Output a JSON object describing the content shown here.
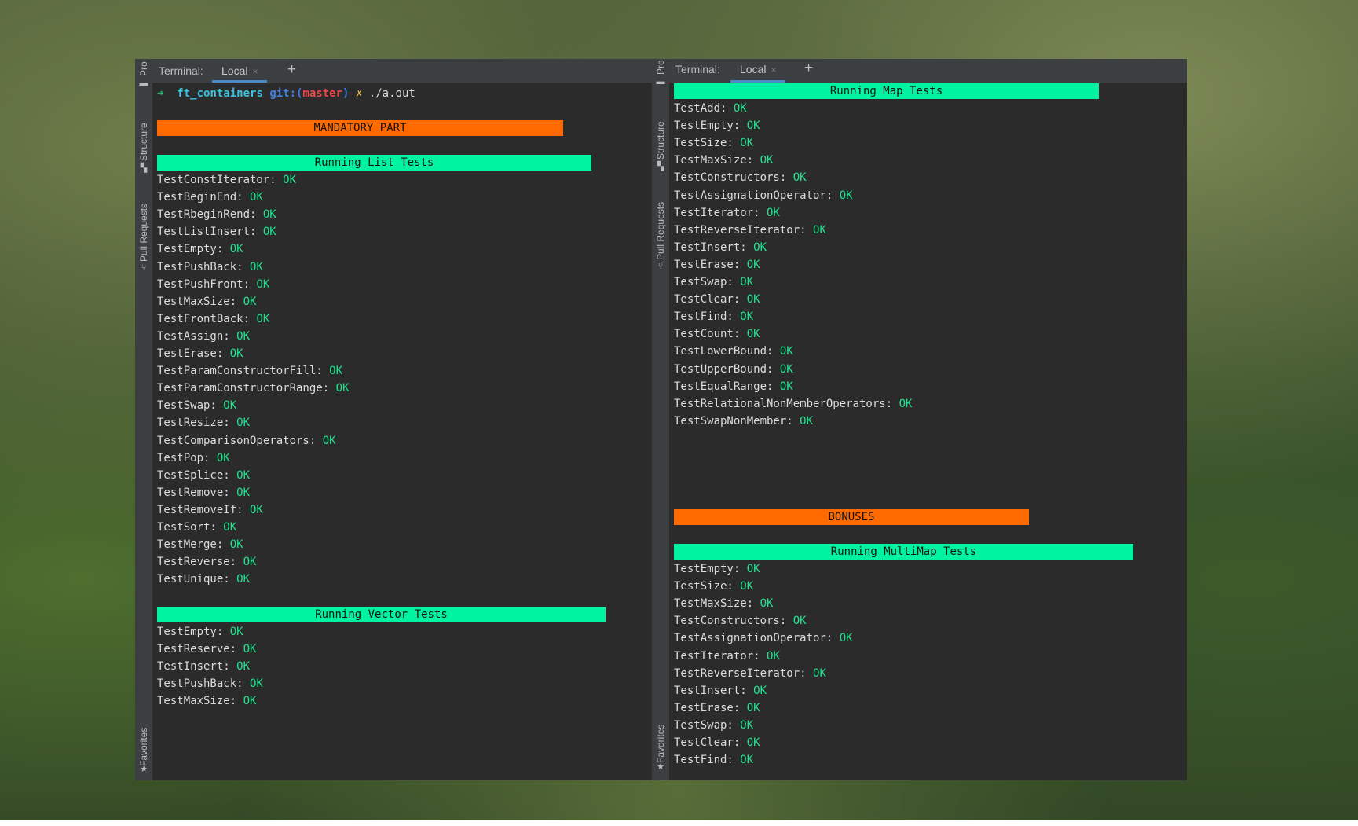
{
  "left_window": {
    "sidebar": {
      "top_label": "Pro",
      "structure": "Structure",
      "pull_requests": "Pull Requests",
      "favorites": "Favorites"
    },
    "tabbar": {
      "title": "Terminal:",
      "tab": "Local",
      "close": "×",
      "add": "+"
    },
    "prompt": {
      "arrow": "➜",
      "dir": "ft_containers",
      "git": "git:(",
      "branch": "master",
      "git_close": ")",
      "dirty": "✗",
      "command": "./a.out"
    },
    "mandatory_banner": "MANDATORY PART",
    "list_banner": "Running List Tests",
    "list_tests": [
      {
        "name": "TestConstIterator:",
        "status": "OK"
      },
      {
        "name": "TestBeginEnd:",
        "status": "OK"
      },
      {
        "name": "TestRbeginRend:",
        "status": "OK"
      },
      {
        "name": "TestListInsert:",
        "status": "OK"
      },
      {
        "name": "TestEmpty:",
        "status": "OK"
      },
      {
        "name": "TestPushBack:",
        "status": "OK"
      },
      {
        "name": "TestPushFront:",
        "status": "OK"
      },
      {
        "name": "TestMaxSize:",
        "status": "OK"
      },
      {
        "name": "TestFrontBack:",
        "status": "OK"
      },
      {
        "name": "TestAssign:",
        "status": "OK"
      },
      {
        "name": "TestErase:",
        "status": "OK"
      },
      {
        "name": "TestParamConstructorFill:",
        "status": "OK"
      },
      {
        "name": "TestParamConstructorRange:",
        "status": "OK"
      },
      {
        "name": "TestSwap:",
        "status": "OK"
      },
      {
        "name": "TestResize:",
        "status": "OK"
      },
      {
        "name": "TestComparisonOperators:",
        "status": "OK"
      },
      {
        "name": "TestPop:",
        "status": "OK"
      },
      {
        "name": "TestSplice:",
        "status": "OK"
      },
      {
        "name": "TestRemove:",
        "status": "OK"
      },
      {
        "name": "TestRemoveIf:",
        "status": "OK"
      },
      {
        "name": "TestSort:",
        "status": "OK"
      },
      {
        "name": "TestMerge:",
        "status": "OK"
      },
      {
        "name": "TestReverse:",
        "status": "OK"
      },
      {
        "name": "TestUnique:",
        "status": "OK"
      }
    ],
    "vector_banner": "Running Vector Tests",
    "vector_tests": [
      {
        "name": "TestEmpty:",
        "status": "OK"
      },
      {
        "name": "TestReserve:",
        "status": "OK"
      },
      {
        "name": "TestInsert:",
        "status": "OK"
      },
      {
        "name": "TestPushBack:",
        "status": "OK"
      },
      {
        "name": "TestMaxSize:",
        "status": "OK"
      }
    ]
  },
  "right_window": {
    "sidebar": {
      "top_label": "Pro",
      "structure": "Structure",
      "pull_requests": "Pull Requests",
      "favorites": "Favorites"
    },
    "tabbar": {
      "title": "Terminal:",
      "tab": "Local",
      "close": "×",
      "add": "+"
    },
    "map_banner": "Running Map Tests",
    "map_tests": [
      {
        "name": "TestAdd:",
        "status": "OK"
      },
      {
        "name": "TestEmpty:",
        "status": "OK"
      },
      {
        "name": "TestSize:",
        "status": "OK"
      },
      {
        "name": "TestMaxSize:",
        "status": "OK"
      },
      {
        "name": "TestConstructors:",
        "status": "OK"
      },
      {
        "name": "TestAssignationOperator:",
        "status": "OK"
      },
      {
        "name": "TestIterator:",
        "status": "OK"
      },
      {
        "name": "TestReverseIterator:",
        "status": "OK"
      },
      {
        "name": "TestInsert:",
        "status": "OK"
      },
      {
        "name": "TestErase:",
        "status": "OK"
      },
      {
        "name": "TestSwap:",
        "status": "OK"
      },
      {
        "name": "TestClear:",
        "status": "OK"
      },
      {
        "name": "TestFind:",
        "status": "OK"
      },
      {
        "name": "TestCount:",
        "status": "OK"
      },
      {
        "name": "TestLowerBound:",
        "status": "OK"
      },
      {
        "name": "TestUpperBound:",
        "status": "OK"
      },
      {
        "name": "TestEqualRange:",
        "status": "OK"
      },
      {
        "name": "TestRelationalNonMemberOperators:",
        "status": "OK"
      },
      {
        "name": "TestSwapNonMember:",
        "status": "OK"
      }
    ],
    "bonuses_banner": "BONUSES",
    "multimap_banner": "Running MultiMap Tests",
    "multimap_tests": [
      {
        "name": "TestEmpty:",
        "status": "OK"
      },
      {
        "name": "TestSize:",
        "status": "OK"
      },
      {
        "name": "TestMaxSize:",
        "status": "OK"
      },
      {
        "name": "TestConstructors:",
        "status": "OK"
      },
      {
        "name": "TestAssignationOperator:",
        "status": "OK"
      },
      {
        "name": "TestIterator:",
        "status": "OK"
      },
      {
        "name": "TestReverseIterator:",
        "status": "OK"
      },
      {
        "name": "TestInsert:",
        "status": "OK"
      },
      {
        "name": "TestErase:",
        "status": "OK"
      },
      {
        "name": "TestSwap:",
        "status": "OK"
      },
      {
        "name": "TestClear:",
        "status": "OK"
      },
      {
        "name": "TestFind:",
        "status": "OK"
      }
    ]
  }
}
